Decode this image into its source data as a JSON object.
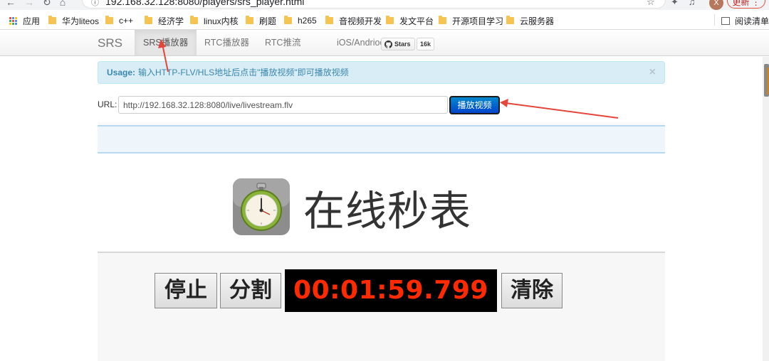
{
  "browser": {
    "url": "192.168.32.128:8080/players/srs_player.html",
    "avatar_letter": "X",
    "update_label": "更新",
    "menu_glyph": "⋮"
  },
  "bookmarks": {
    "apps_label": "应用",
    "items": [
      "华为liteos",
      "c++",
      "经济学",
      "linux内核",
      "刷题",
      "h265",
      "音视频开发",
      "发文平台",
      "开源项目学习",
      "云服务器"
    ],
    "reading_list": "阅读清单"
  },
  "navbar": {
    "brand": "SRS",
    "items": [
      "SRS播放器",
      "RTC播放器",
      "RTC推流",
      "iOS/Andriod"
    ],
    "active_index": 0,
    "github_stars_label": "Stars",
    "github_stars_count": "16k"
  },
  "alert": {
    "title": "Usage:",
    "message": "输入HTTP-FLV/HLS地址后点击\"播放视频\"即可播放视频",
    "close_glyph": "×"
  },
  "form": {
    "url_label": "URL:",
    "url_value": "http://192.168.32.128:8080/live/livestream.flv",
    "play_label": "播放视频"
  },
  "stopwatch": {
    "title": "在线秒表",
    "stop_label": "停止",
    "split_label": "分割",
    "time": "00:01:59.799",
    "clear_label": "清除"
  },
  "colors": {
    "accent_red": "#e5453a",
    "play_button": "#0044cc",
    "timer_digits": "#ff2a00",
    "alert_bg": "#d9edf7"
  },
  "icons": [
    "back-icon",
    "forward-icon",
    "reload-icon",
    "home-icon",
    "info-icon",
    "star-icon",
    "extensions-icon",
    "media-icon",
    "apps-icon",
    "folder-icon",
    "reading-list-icon",
    "github-icon",
    "stopwatch-icon",
    "close-icon"
  ]
}
